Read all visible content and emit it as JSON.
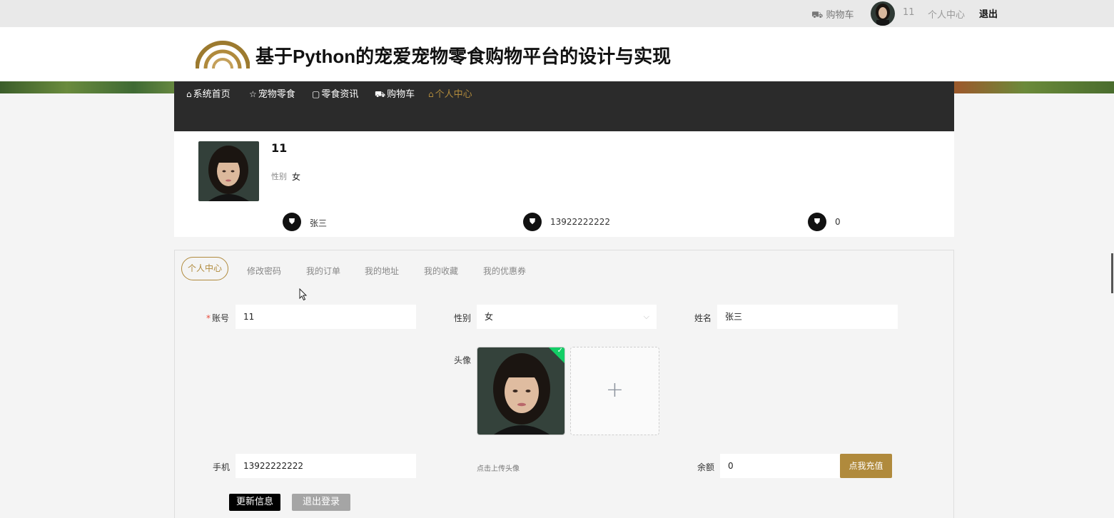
{
  "topbar": {
    "cart_label": "购物车",
    "username": "11",
    "center_label": "个人中心",
    "logout_label": "退出"
  },
  "header": {
    "title": "基于Python的宠爱宠物零食购物平台的设计与实现"
  },
  "nav": {
    "items": [
      {
        "label": "系统首页",
        "icon": "home-icon"
      },
      {
        "label": "宠物零食",
        "icon": "star-icon"
      },
      {
        "label": "零食资讯",
        "icon": "bag-icon"
      },
      {
        "label": "购物车",
        "icon": "truck-icon"
      },
      {
        "label": "个人中心",
        "icon": "home-icon",
        "active": true
      }
    ]
  },
  "profile": {
    "name": "11",
    "gender_label": "性别",
    "gender_value": "女",
    "stats": [
      {
        "icon": "shield-icon",
        "value": "张三"
      },
      {
        "icon": "shield-icon",
        "value": "13922222222"
      },
      {
        "icon": "shield-icon",
        "value": "0"
      }
    ]
  },
  "tabs": [
    "个人中心",
    "修改密码",
    "我的订单",
    "我的地址",
    "我的收藏",
    "我的优惠券"
  ],
  "form": {
    "account_label": "账号",
    "account_value": "11",
    "gender_label": "性别",
    "gender_value": "女",
    "name_label": "姓名",
    "name_value": "张三",
    "avatar_label": "头像",
    "upload_tip": "点击上传头像",
    "phone_label": "手机",
    "phone_value": "13922222222",
    "balance_label": "余额",
    "balance_value": "0",
    "recharge_label": "点我充值",
    "update_label": "更新信息",
    "logout_label": "退出登录"
  },
  "colors": {
    "accent": "#b08a3c",
    "nav_bg": "#2b2b2b",
    "success": "#13ce66"
  }
}
